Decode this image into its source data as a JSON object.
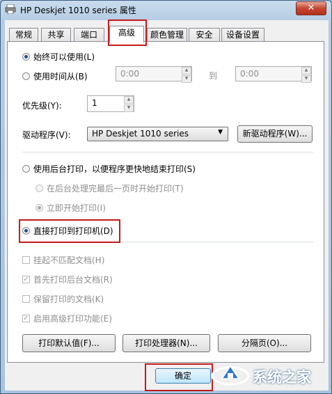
{
  "window": {
    "title": "HP Deskjet 1010 series 属性"
  },
  "tabs": [
    {
      "label": "常规"
    },
    {
      "label": "共享"
    },
    {
      "label": "端口"
    },
    {
      "label": "高级"
    },
    {
      "label": "颜色管理"
    },
    {
      "label": "安全"
    },
    {
      "label": "设备设置"
    }
  ],
  "availability": {
    "always_label": "始终可以使用(L)",
    "timed_label": "使用时间从(B)",
    "from_value": "0:00",
    "to_label": "到",
    "to_value": "0:00"
  },
  "priority": {
    "label": "优先级(Y):",
    "value": "1"
  },
  "driver": {
    "label": "驱动程序(V):",
    "selected": "HP Deskjet 1010 series",
    "new_driver_button": "新驱动程序(W)..."
  },
  "spool": {
    "spool_label": "使用后台打印，以便程序更快地结束打印(S)",
    "after_last_page_label": "在后台处理完最后一页时开始打印(T)",
    "immediately_label": "立即开始打印(I)",
    "direct_label": "直接打印到打印机(D)"
  },
  "options": [
    {
      "label": "挂起不匹配文档(H)",
      "checked": false
    },
    {
      "label": "首先打印后台文档(R)",
      "checked": true
    },
    {
      "label": "保留打印的文档(K)",
      "checked": false
    },
    {
      "label": "启用高级打印功能(E)",
      "checked": true
    }
  ],
  "buttons": {
    "defaults": "打印默认值(F)...",
    "processor": "打印处理器(N)...",
    "separator": "分隔页(O)...",
    "ok": "确定"
  },
  "watermark": {
    "text": "系统之家"
  },
  "colors": {
    "highlight": "#c41a1a",
    "accent": "#1c4f8e"
  }
}
